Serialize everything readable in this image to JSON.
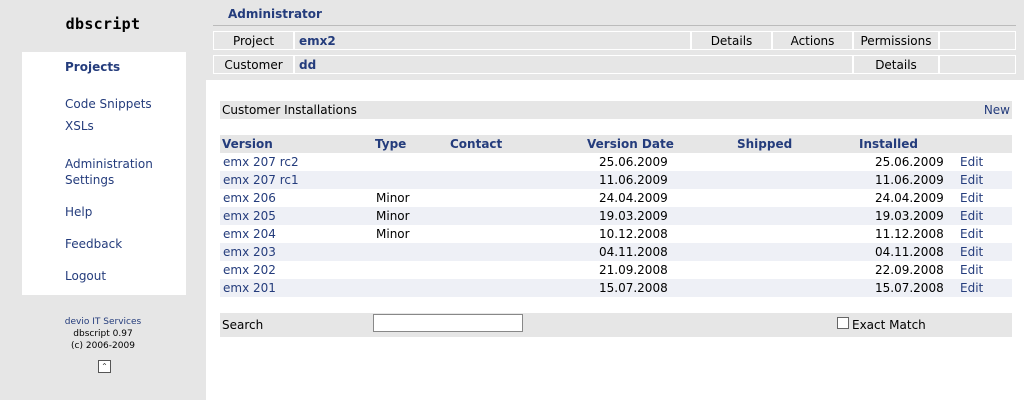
{
  "app": {
    "logo": "dbscript"
  },
  "sidebar": {
    "items": [
      {
        "label": "Projects",
        "active": true
      },
      {
        "label": "Code Snippets"
      },
      {
        "label": "XSLs"
      },
      {
        "label": "Administration"
      },
      {
        "label": "Settings"
      },
      {
        "label": "Help"
      },
      {
        "label": "Feedback"
      },
      {
        "label": "Logout"
      }
    ],
    "footer": {
      "company": "devio IT Services",
      "version": "dbscript 0.97",
      "copyright": "(c) 2006-2009"
    },
    "top_icon": "scroll-top-icon"
  },
  "header": {
    "title": "Administrator",
    "project_label": "Project",
    "project_value": "emx2",
    "project_buttons": [
      "Details",
      "Actions",
      "Permissions"
    ],
    "customer_label": "Customer",
    "customer_value": "dd",
    "customer_buttons": [
      "Details"
    ]
  },
  "section": {
    "title": "Customer Installations",
    "new_label": "New"
  },
  "table": {
    "columns": [
      "Version",
      "Type",
      "Contact",
      "Version Date",
      "Shipped",
      "Installed"
    ],
    "edit_label": "Edit",
    "rows": [
      {
        "version": "emx 207 rc2",
        "type": "",
        "contact": "",
        "version_date": "25.06.2009",
        "shipped": "",
        "installed": "25.06.2009"
      },
      {
        "version": "emx 207 rc1",
        "type": "",
        "contact": "",
        "version_date": "11.06.2009",
        "shipped": "",
        "installed": "11.06.2009"
      },
      {
        "version": "emx 206",
        "type": "Minor",
        "contact": "",
        "version_date": "24.04.2009",
        "shipped": "",
        "installed": "24.04.2009"
      },
      {
        "version": "emx 205",
        "type": "Minor",
        "contact": "",
        "version_date": "19.03.2009",
        "shipped": "",
        "installed": "19.03.2009"
      },
      {
        "version": "emx 204",
        "type": "Minor",
        "contact": "",
        "version_date": "10.12.2008",
        "shipped": "",
        "installed": "11.12.2008"
      },
      {
        "version": "emx 203",
        "type": "",
        "contact": "",
        "version_date": "04.11.2008",
        "shipped": "",
        "installed": "04.11.2008"
      },
      {
        "version": "emx 202",
        "type": "",
        "contact": "",
        "version_date": "21.09.2008",
        "shipped": "",
        "installed": "22.09.2008"
      },
      {
        "version": "emx 201",
        "type": "",
        "contact": "",
        "version_date": "15.07.2008",
        "shipped": "",
        "installed": "15.07.2008"
      }
    ]
  },
  "search": {
    "label": "Search",
    "value": "",
    "exact_match_label": "Exact Match",
    "exact_match_checked": false
  },
  "colors": {
    "link": "#243c7c",
    "panel": "#e6e6e6",
    "row_alt": "#eef0f6"
  }
}
